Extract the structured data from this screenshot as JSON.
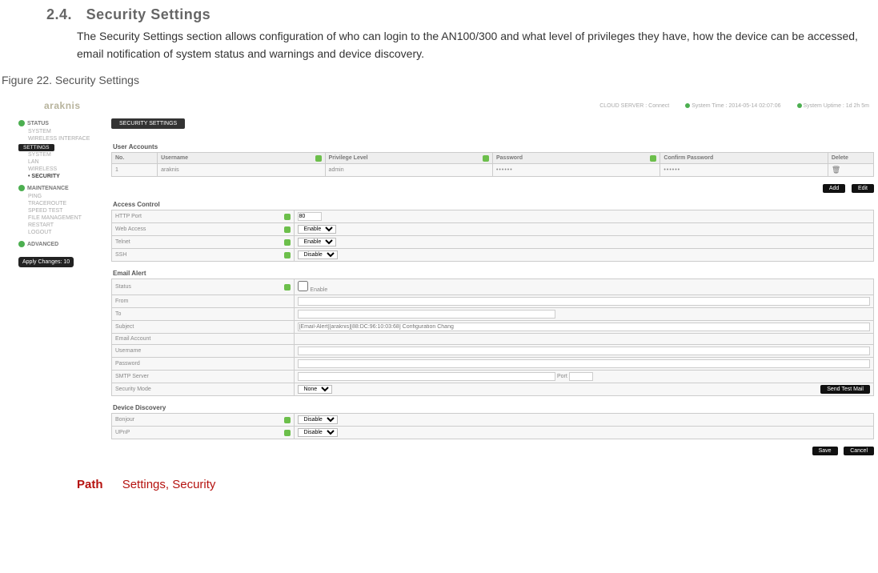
{
  "doc": {
    "section_number": "2.4.",
    "section_title": "Security Settings",
    "description": "The Security Settings section allows configuration of who can login to the AN100/300 and what level of privileges they have, how the device can be accessed, email notification of system status and warnings and device discovery.",
    "figure_caption": "Figure 22. Security Settings",
    "path_label": "Path",
    "path_value": "Settings, Security"
  },
  "screenshot": {
    "brand": "araknis",
    "topbar": {
      "cloud_server": "CLOUD SERVER : Connect",
      "system_time": "System Time : 2014-05-14 02:07:06",
      "system_uptime": "System Uptime : 1d 2h 5m"
    },
    "title_chip": "SECURITY SETTINGS",
    "sidebar": {
      "status": {
        "label": "STATUS",
        "items": [
          "SYSTEM",
          "WIRELESS INTERFACE"
        ]
      },
      "settings": {
        "label": "SETTINGS",
        "items": [
          "SYSTEM",
          "LAN",
          "WIRELESS",
          "SECURITY"
        ],
        "current": "SECURITY"
      },
      "maintenance": {
        "label": "MAINTENANCE",
        "items": [
          "PING",
          "TRACEROUTE",
          "SPEED TEST",
          "FILE MANAGEMENT",
          "RESTART",
          "LOGOUT"
        ]
      },
      "advanced": {
        "label": "ADVANCED"
      },
      "apply_button": "Apply Changes: 10"
    },
    "user_accounts": {
      "title": "User Accounts",
      "headers": [
        "No.",
        "Username",
        "Privilege Level",
        "Password",
        "Confirm Password",
        "Delete"
      ],
      "row": {
        "no": "1",
        "username": "araknis",
        "privilege": "admin",
        "password": "••••••",
        "confirm": "••••••"
      },
      "add_label": "Add",
      "edit_label": "Edit"
    },
    "access_control": {
      "title": "Access Control",
      "rows": [
        {
          "label": "HTTP Port",
          "value": "80"
        },
        {
          "label": "Web Access",
          "value": "Enable"
        },
        {
          "label": "Telnet",
          "value": "Enable"
        },
        {
          "label": "SSH",
          "value": "Disable"
        }
      ]
    },
    "email_alert": {
      "title": "Email Alert",
      "status_label": "Status",
      "status_value": "Enable",
      "rows": [
        "From",
        "To",
        "Subject",
        "Email Account",
        "Username",
        "Password",
        "SMTP Server",
        "Security Mode"
      ],
      "subject_placeholder": "[Email-Alert][araknis][88:DC:96:10:03:68] Configuration Chang",
      "smtp_port_label": "Port",
      "security_mode_value": "None",
      "test_button": "Send Test Mail"
    },
    "device_discovery": {
      "title": "Device Discovery",
      "rows": [
        {
          "label": "Bonjour",
          "value": "Disable"
        },
        {
          "label": "UPnP",
          "value": "Disable"
        }
      ],
      "save_label": "Save",
      "cancel_label": "Cancel"
    }
  }
}
